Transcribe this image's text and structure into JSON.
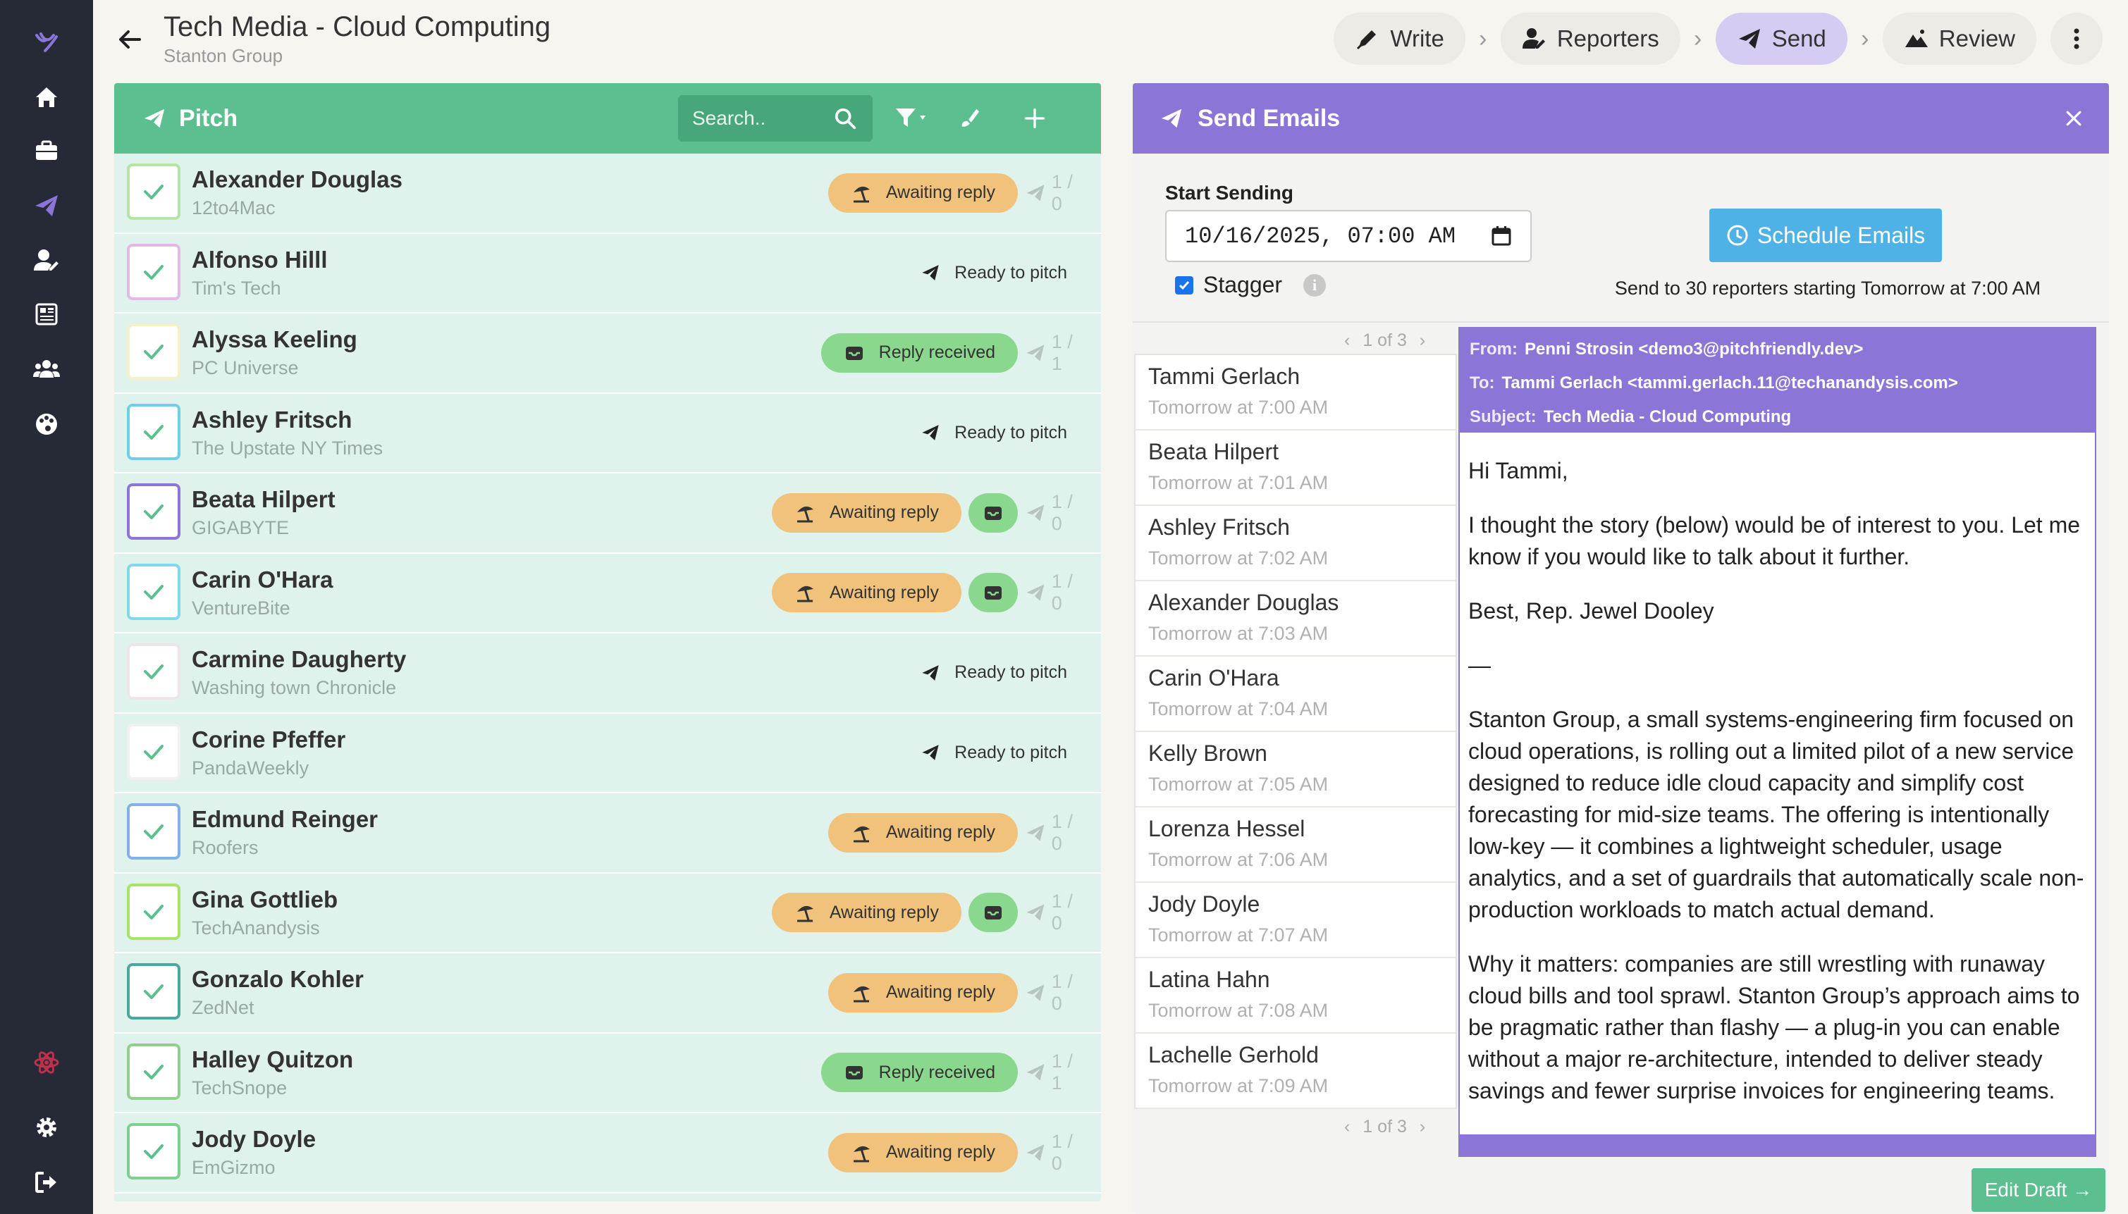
{
  "header": {
    "title": "Tech Media - Cloud Computing",
    "subtitle": "Stanton Group",
    "steps": [
      {
        "label": "Write",
        "icon": "pen-icon"
      },
      {
        "label": "Reporters",
        "icon": "user-edit-icon"
      },
      {
        "label": "Send",
        "icon": "paper-plane-icon",
        "active": true
      },
      {
        "label": "Review",
        "icon": "mountain-icon"
      }
    ]
  },
  "pitch": {
    "title": "Pitch",
    "search_placeholder": "Search..",
    "rows": [
      {
        "name": "Alexander Douglas",
        "publication": "12to4Mac",
        "status": "Awaiting reply",
        "status_type": "await",
        "count": "1 / 0",
        "check_color": "#b7e4a4"
      },
      {
        "name": "Alfonso Hilll",
        "publication": "Tim's Tech",
        "status": "Ready to pitch",
        "status_type": "ready",
        "count": "",
        "check_color": "#e4b7e6"
      },
      {
        "name": "Alyssa Keeling",
        "publication": "PC Universe",
        "status": "Reply received",
        "status_type": "reply",
        "count": "1 / 1",
        "check_color": "#f4f0c8"
      },
      {
        "name": "Ashley Fritsch",
        "publication": "The Upstate NY Times",
        "status": "Ready to pitch",
        "status_type": "ready",
        "count": "",
        "check_color": "#6fcfe8"
      },
      {
        "name": "Beata Hilpert",
        "publication": "GIGABYTE",
        "status": "Awaiting reply",
        "status_type": "await",
        "count": "1 / 0",
        "extra": true,
        "check_color": "#8e74d4"
      },
      {
        "name": "Carin O'Hara",
        "publication": "VentureBite",
        "status": "Awaiting reply",
        "status_type": "await",
        "count": "1 / 0",
        "extra": true,
        "check_color": "#7fd8f0"
      },
      {
        "name": "Carmine Daugherty",
        "publication": "Washing town Chronicle",
        "status": "Ready to pitch",
        "status_type": "ready",
        "count": "",
        "check_color": "#f0e4ec"
      },
      {
        "name": "Corine Pfeffer",
        "publication": "PandaWeekly",
        "status": "Ready to pitch",
        "status_type": "ready",
        "count": "",
        "check_color": "#f1f1f1"
      },
      {
        "name": "Edmund Reinger",
        "publication": "Roofers",
        "status": "Awaiting reply",
        "status_type": "await",
        "count": "1 / 0",
        "check_color": "#7fb2ec"
      },
      {
        "name": "Gina Gottlieb",
        "publication": "TechAnandysis",
        "status": "Awaiting reply",
        "status_type": "await",
        "count": "1 / 0",
        "extra": true,
        "check_color": "#a8e36a"
      },
      {
        "name": "Gonzalo Kohler",
        "publication": "ZedNet",
        "status": "Awaiting reply",
        "status_type": "await",
        "count": "1 / 0",
        "check_color": "#4aa99a"
      },
      {
        "name": "Halley Quitzon",
        "publication": "TechSnope",
        "status": "Reply received",
        "status_type": "reply",
        "count": "1 / 1",
        "check_color": "#8fd18a"
      },
      {
        "name": "Jody Doyle",
        "publication": "EmGizmo",
        "status": "Awaiting reply",
        "status_type": "await",
        "count": "1 / 0",
        "check_color": "#7fcf8f"
      }
    ]
  },
  "send": {
    "title": "Send Emails",
    "start_label": "Start Sending",
    "date_value": "10/16/2025, 07:00 AM",
    "stagger_label": "Stagger",
    "schedule_label": "Schedule Emails",
    "send_note": "Send to 30 reporters starting Tomorrow at 7:00 AM",
    "pager": "1 of 3",
    "recipients": [
      {
        "name": "Tammi Gerlach",
        "time": "Tomorrow at 7:00 AM"
      },
      {
        "name": "Beata Hilpert",
        "time": "Tomorrow at 7:01 AM"
      },
      {
        "name": "Ashley Fritsch",
        "time": "Tomorrow at 7:02 AM"
      },
      {
        "name": "Alexander Douglas",
        "time": "Tomorrow at 7:03 AM"
      },
      {
        "name": "Carin O'Hara",
        "time": "Tomorrow at 7:04 AM"
      },
      {
        "name": "Kelly Brown",
        "time": "Tomorrow at 7:05 AM"
      },
      {
        "name": "Lorenza Hessel",
        "time": "Tomorrow at 7:06 AM"
      },
      {
        "name": "Jody Doyle",
        "time": "Tomorrow at 7:07 AM"
      },
      {
        "name": "Latina Hahn",
        "time": "Tomorrow at 7:08 AM"
      },
      {
        "name": "Lachelle Gerhold",
        "time": "Tomorrow at 7:09 AM"
      }
    ],
    "email": {
      "from_label": "From:",
      "from": "Penni Strosin <demo3@pitchfriendly.dev>",
      "to_label": "To:",
      "to": "Tammi Gerlach <tammi.gerlach.11@techanandysis.com>",
      "subject_label": "Subject:",
      "subject": "Tech Media - Cloud Computing",
      "body": [
        "Hi Tammi,",
        "I thought the story (below) would be of interest to you. Let me know if you would like to talk about it further.",
        "Best, Rep. Jewel Dooley",
        "—",
        "Stanton Group, a small systems-engineering firm focused on cloud operations, is rolling out a limited pilot of a new service designed to reduce idle cloud capacity and simplify cost forecasting for mid-size teams. The offering is intentionally low-key — it combines a lightweight scheduler, usage analytics, and a set of guardrails that automatically scale non-production workloads to match actual demand.",
        "Why it matters: companies are still wrestling with runaway cloud bills and tool sprawl. Stanton Group’s approach aims to be pragmatic rather than flashy — a plug-in you can enable without a major re-architecture, intended to deliver steady savings and fewer surprise invoices for engineering teams."
      ]
    },
    "edit_label": "Edit Draft →"
  }
}
